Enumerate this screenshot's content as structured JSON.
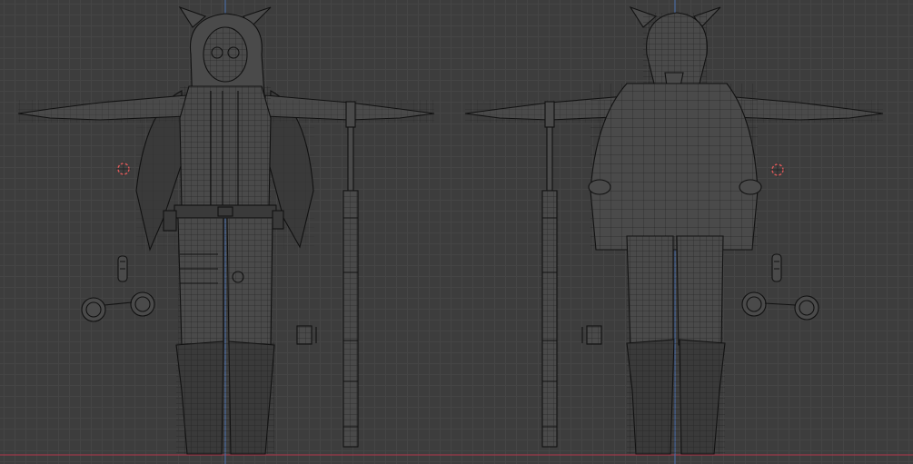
{
  "viewport": {
    "background_color": "#3d3d3d",
    "grid_minor_color": "#454545",
    "grid_major_color": "#4b4b4b",
    "axis_x_color": "#9b3a4a",
    "axis_z_color": "#4a6aa0",
    "wire_color": "#111111",
    "cursor_color": "#e05a5a"
  },
  "views": [
    {
      "name": "front-view",
      "objects": [
        "character-front",
        "staff-front",
        "keychain-front",
        "handcuffs-front",
        "small-box-front",
        "3d-cursor-front"
      ]
    },
    {
      "name": "back-view",
      "objects": [
        "character-back",
        "staff-back",
        "keychain-back",
        "handcuffs-back",
        "small-box-back",
        "3d-cursor-back"
      ]
    }
  ]
}
